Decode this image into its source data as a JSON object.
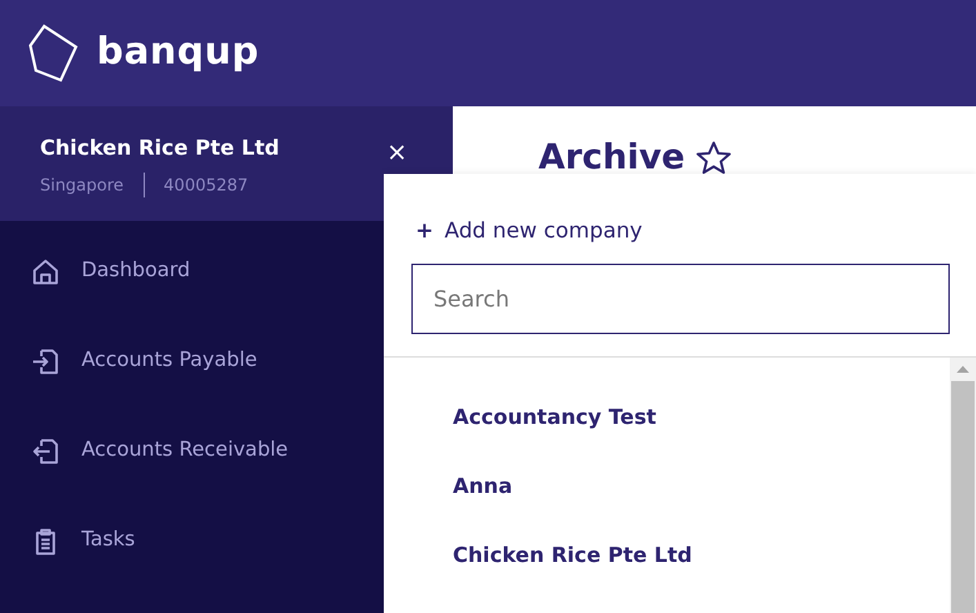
{
  "header": {
    "logo_text": "banqup"
  },
  "company": {
    "name": "Chicken Rice Pte Ltd",
    "country": "Singapore",
    "number": "40005287",
    "close": "×"
  },
  "nav": [
    {
      "label": "Dashboard",
      "kind": "home"
    },
    {
      "label": "Accounts Payable",
      "kind": "in"
    },
    {
      "label": "Accounts Receivable",
      "kind": "out"
    },
    {
      "label": "Tasks",
      "kind": "tasks"
    }
  ],
  "page": {
    "title": "Archive",
    "favorite": false
  },
  "company_menu": {
    "add_icon": "+",
    "add_label": "Add new company",
    "search": {
      "placeholder": "Search"
    },
    "companies": [
      {
        "name": "Accountancy Test"
      },
      {
        "name": "Anna"
      },
      {
        "name": "Chicken Rice Pte Ltd"
      }
    ]
  }
}
